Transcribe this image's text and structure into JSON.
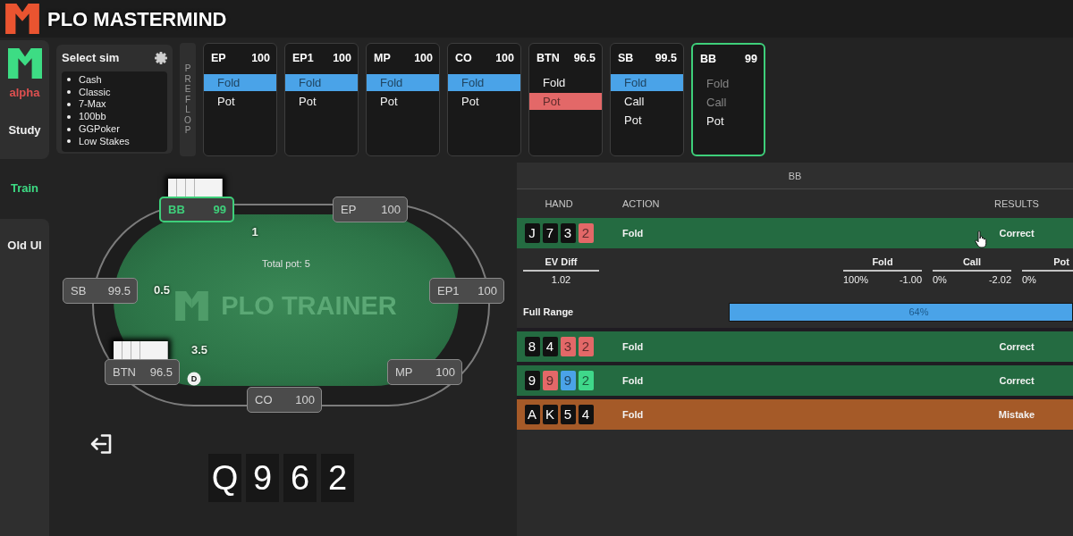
{
  "header": {
    "title": "PLO MASTERMIND"
  },
  "sidebar": {
    "badge": "alpha",
    "items": [
      {
        "label": "Study",
        "selected": false
      },
      {
        "label": "Train",
        "selected": true
      },
      {
        "label": "Old UI",
        "selected": false
      }
    ]
  },
  "sim_selector": {
    "title": "Select sim",
    "options": [
      "Cash",
      "Classic",
      "7-Max",
      "100bb",
      "GGPoker",
      "Low Stakes"
    ]
  },
  "street": "PREFLOP",
  "positions": [
    {
      "name": "EP",
      "stack": "100",
      "selected": false,
      "actions": [
        {
          "label": "Fold",
          "selected": true,
          "disabled": false,
          "color": "#4aa3e8"
        },
        {
          "label": "Pot",
          "selected": false,
          "disabled": false
        }
      ]
    },
    {
      "name": "EP1",
      "stack": "100",
      "selected": false,
      "actions": [
        {
          "label": "Fold",
          "selected": true,
          "disabled": false,
          "color": "#4aa3e8"
        },
        {
          "label": "Pot",
          "selected": false,
          "disabled": false
        }
      ]
    },
    {
      "name": "MP",
      "stack": "100",
      "selected": false,
      "actions": [
        {
          "label": "Fold",
          "selected": true,
          "disabled": false,
          "color": "#4aa3e8"
        },
        {
          "label": "Pot",
          "selected": false,
          "disabled": false
        }
      ]
    },
    {
      "name": "CO",
      "stack": "100",
      "selected": false,
      "actions": [
        {
          "label": "Fold",
          "selected": true,
          "disabled": false,
          "color": "#4aa3e8"
        },
        {
          "label": "Pot",
          "selected": false,
          "disabled": false
        }
      ]
    },
    {
      "name": "BTN",
      "stack": "96.5",
      "selected": false,
      "actions": [
        {
          "label": "Fold",
          "selected": false,
          "disabled": false
        },
        {
          "label": "Pot",
          "selected": true,
          "disabled": false,
          "color": "#e36868"
        }
      ]
    },
    {
      "name": "SB",
      "stack": "99.5",
      "selected": false,
      "actions": [
        {
          "label": "Fold",
          "selected": true,
          "disabled": false,
          "color": "#4aa3e8"
        },
        {
          "label": "Call",
          "selected": false,
          "disabled": false
        },
        {
          "label": "Pot",
          "selected": false,
          "disabled": false
        }
      ]
    },
    {
      "name": "BB",
      "stack": "99",
      "selected": true,
      "actions": [
        {
          "label": "Fold",
          "selected": false,
          "disabled": true
        },
        {
          "label": "Call",
          "selected": false,
          "disabled": true
        },
        {
          "label": "Pot",
          "selected": false,
          "disabled": false
        }
      ]
    }
  ],
  "table": {
    "total_pot": "Total pot: 5",
    "felt_title": "PLO TRAINER",
    "dealer_label": "D",
    "seats": [
      {
        "position": "BB",
        "stack": "99",
        "active": true,
        "has_cards": true,
        "dealer": false,
        "bet": "1"
      },
      {
        "position": "EP",
        "stack": "100",
        "active": false,
        "has_cards": false,
        "dealer": false
      },
      {
        "position": "EP1",
        "stack": "100",
        "active": false,
        "has_cards": false,
        "dealer": false
      },
      {
        "position": "MP",
        "stack": "100",
        "active": false,
        "has_cards": false,
        "dealer": false
      },
      {
        "position": "CO",
        "stack": "100",
        "active": false,
        "has_cards": false,
        "dealer": false
      },
      {
        "position": "BTN",
        "stack": "96.5",
        "active": false,
        "has_cards": true,
        "dealer": true,
        "bet": "3.5"
      },
      {
        "position": "SB",
        "stack": "99.5",
        "active": false,
        "has_cards": false,
        "dealer": false,
        "bet": "0.5"
      }
    ],
    "hero_hand": [
      "Q",
      "9",
      "6",
      "2"
    ]
  },
  "results": {
    "title": "BB",
    "columns": [
      "HAND",
      "ACTION",
      "RESULTS"
    ],
    "rows": [
      {
        "hand": [
          {
            "rank": "J",
            "color": "#111111"
          },
          {
            "rank": "7",
            "color": "#111111"
          },
          {
            "rank": "3",
            "color": "#111111"
          },
          {
            "rank": "2",
            "color": "#e36868"
          }
        ],
        "action": "Fold",
        "result": "Correct",
        "color": "#246b41",
        "details": {
          "ev_label": "EV Diff",
          "ev_value": "1.02",
          "actions": [
            {
              "label": "Fold",
              "frequency": "100%",
              "ev": "-1.00"
            },
            {
              "label": "Call",
              "frequency": "0%",
              "ev": "-2.02"
            },
            {
              "label": "Pot",
              "frequency": "0%"
            }
          ],
          "range_label": "Full Range",
          "range_value": "64%"
        }
      },
      {
        "hand": [
          {
            "rank": "8",
            "color": "#111111"
          },
          {
            "rank": "4",
            "color": "#111111"
          },
          {
            "rank": "3",
            "color": "#e36868"
          },
          {
            "rank": "2",
            "color": "#e36868"
          }
        ],
        "action": "Fold",
        "result": "Correct",
        "color": "#246b41"
      },
      {
        "hand": [
          {
            "rank": "9",
            "color": "#111111"
          },
          {
            "rank": "9",
            "color": "#e36868"
          },
          {
            "rank": "9",
            "color": "#4aa3e8"
          },
          {
            "rank": "2",
            "color": "#3fd88a"
          }
        ],
        "action": "Fold",
        "result": "Correct",
        "color": "#246b41"
      },
      {
        "hand": [
          {
            "rank": "A",
            "color": "#111111"
          },
          {
            "rank": "K",
            "color": "#111111"
          },
          {
            "rank": "5",
            "color": "#111111"
          },
          {
            "rank": "4",
            "color": "#111111"
          }
        ],
        "action": "Fold",
        "result": "Mistake",
        "color": "#a55a28"
      }
    ]
  }
}
